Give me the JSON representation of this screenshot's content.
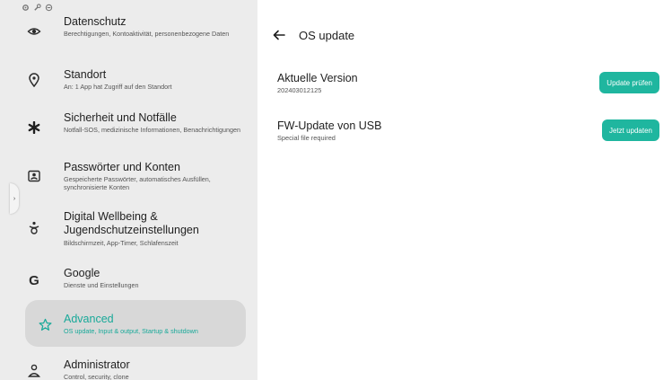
{
  "status_bar": {
    "icons": [
      "settings-gear-icon",
      "wrench-icon",
      "location-icon"
    ]
  },
  "sidebar": {
    "items": [
      {
        "id": "privacy",
        "icon": "privacy-eye-icon",
        "label": "Datenschutz",
        "sub": "Berechtigungen, Kontoaktivität, personenbezogene Daten"
      },
      {
        "id": "location",
        "icon": "location-pin-icon",
        "label": "Standort",
        "sub": "An: 1 App hat Zugriff auf den Standort"
      },
      {
        "id": "safety",
        "icon": "asterisk-icon",
        "label": "Sicherheit und Notfälle",
        "sub": "Notfall-SOS, medizinische Informationen, Benachrichtigungen"
      },
      {
        "id": "accounts",
        "icon": "account-card-icon",
        "label": "Passwörter und Konten",
        "sub": "Gespeicherte Passwörter, automatisches Ausfüllen, synchronisierte Konten"
      },
      {
        "id": "wellbeing",
        "icon": "wellbeing-icon",
        "label": "Digital Wellbeing & Jugendschutzeinstellungen",
        "sub": "Bildschirmzeit, App-Timer, Schlafenszeit"
      },
      {
        "id": "google",
        "icon": "google-g-icon",
        "label": "Google",
        "sub": "Dienste und Einstellungen"
      },
      {
        "id": "advanced",
        "icon": "advanced-star-icon",
        "label": "Advanced",
        "sub": "OS update, Input & output, Startup & shutdown",
        "active": true
      },
      {
        "id": "admin",
        "icon": "administrator-person-icon",
        "label": "Administrator",
        "sub": "Control, security, clone"
      }
    ]
  },
  "header": {
    "title": "OS update"
  },
  "rows": [
    {
      "title": "Aktuelle Version",
      "sub": "202403012125",
      "button": "Update prüfen"
    },
    {
      "title": "FW-Update von USB",
      "sub": "Special file required",
      "button": "Jetzt updaten"
    }
  ],
  "colors": {
    "accent": "#1fb69f",
    "sidebar_bg": "#ececec",
    "active_bg": "#d8d8d8"
  }
}
